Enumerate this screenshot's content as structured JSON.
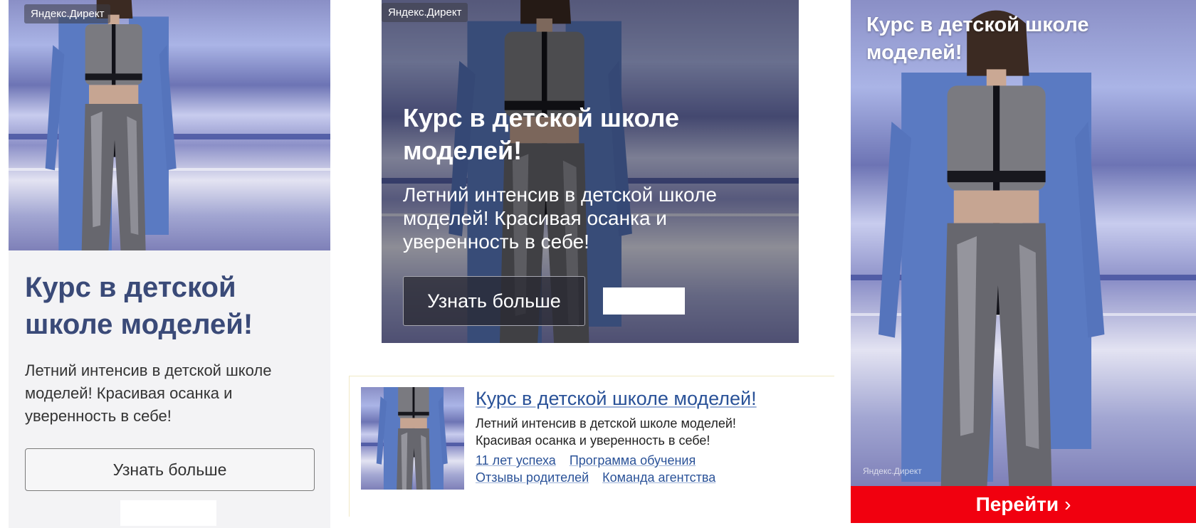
{
  "brand": {
    "badge": "Яндекс.Директ",
    "accent": "#f1000f",
    "link_color": "#2a5298",
    "title_color": "#3a4a78"
  },
  "ad_vertical": {
    "title": "Курс в детской школе моделей!",
    "text": "Летний интенсив в детской школе моделей! Красивая осанка и уверенность в себе!",
    "button": "Узнать больше"
  },
  "ad_overlay": {
    "title": "Курс в детской школе моделей!",
    "text": "Летний интенсив в детской школе моделей! Красивая осанка и уверенность в себе!",
    "button": "Узнать больше"
  },
  "ad_text": {
    "title": "Курс в детской школе моделей!",
    "text": "Летний интенсив в детской школе моделей! Красивая осанка и уверенность в себе!",
    "links": [
      "11 лет успеха",
      "Программа обучения",
      "Отзывы родителей",
      "Команда агентства"
    ]
  },
  "ad_tall": {
    "title": "Курс в детской школе моделей!",
    "cta": "Перейти",
    "cta_arrow": "›"
  }
}
